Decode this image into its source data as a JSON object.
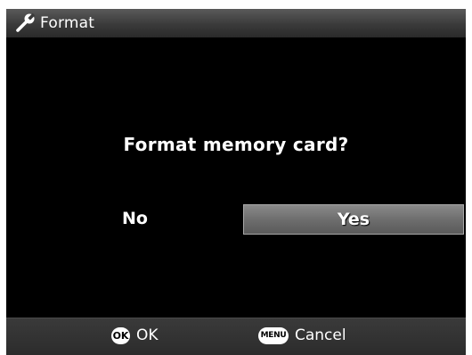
{
  "header": {
    "title": "Format",
    "icon": "wrench-icon"
  },
  "dialog": {
    "question": "Format memory card?",
    "option_no": "No",
    "option_yes": "Yes",
    "selected": "Yes"
  },
  "footer": {
    "ok_badge": "OK",
    "ok_label": "OK",
    "menu_badge": "MENU",
    "cancel_label": "Cancel"
  },
  "colors": {
    "background": "#000000",
    "text": "#ffffff",
    "highlight": "#6e6e6e"
  }
}
